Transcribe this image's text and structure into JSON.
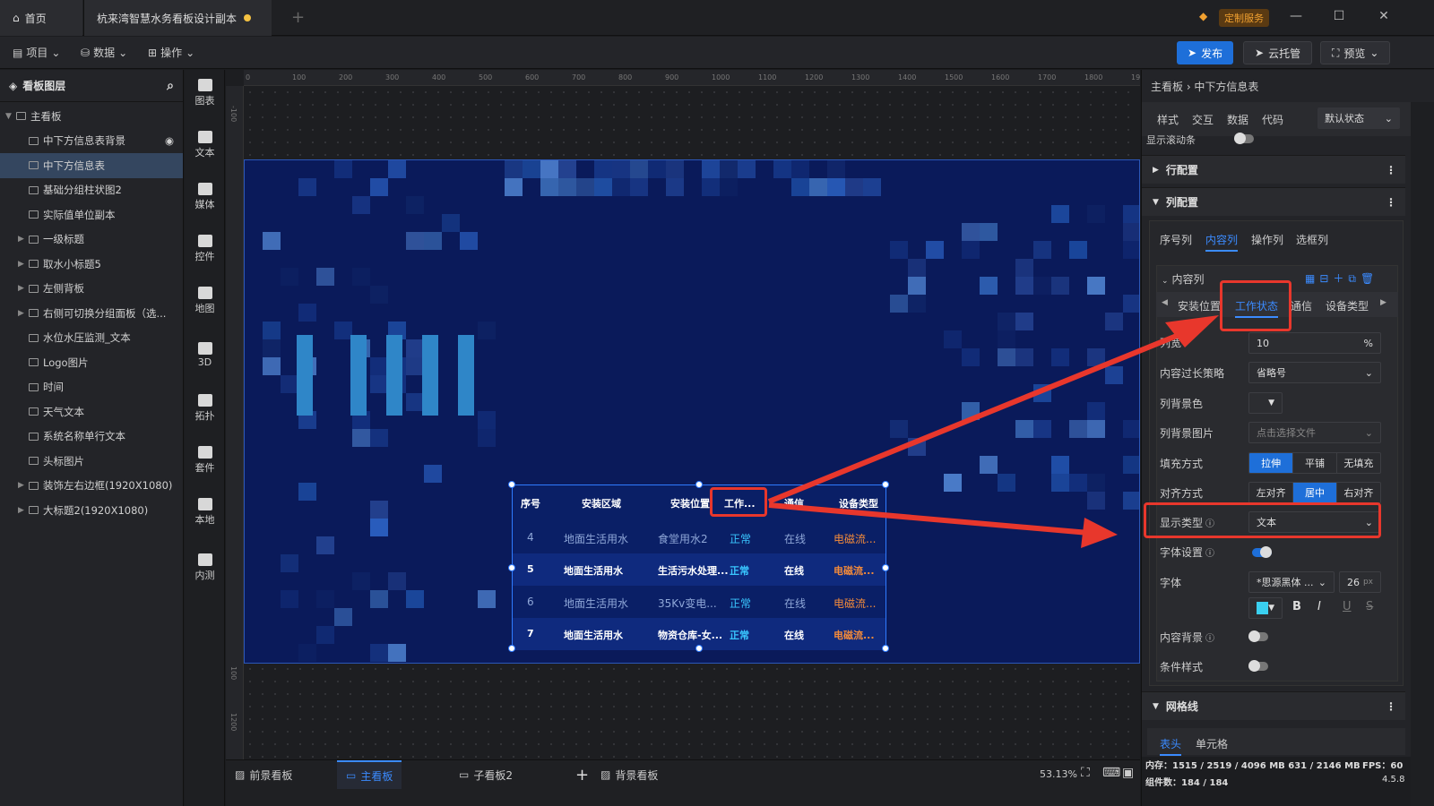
{
  "titlebar": {
    "home_tab": "首页",
    "doc_tab": "杭来湾智慧水务看板设计副本",
    "custom_service": "定制服务"
  },
  "toolbar": {
    "project": "项目",
    "data": "数据",
    "operation": "操作",
    "publish": "发布",
    "cloud": "云托管",
    "preview": "预览"
  },
  "layers": {
    "title": "看板图层",
    "items": [
      {
        "label": "主看板",
        "expanded": true
      },
      {
        "label": "中下方信息表背景"
      },
      {
        "label": "中下方信息表"
      },
      {
        "label": "基础分组柱状图2"
      },
      {
        "label": "实际值单位副本"
      },
      {
        "label": "一级标题"
      },
      {
        "label": "取水小标题5"
      },
      {
        "label": "左侧背板"
      },
      {
        "label": "右侧可切换分组面板（选..."
      },
      {
        "label": "水位水压监测_文本"
      },
      {
        "label": "Logo图片"
      },
      {
        "label": "时间"
      },
      {
        "label": "天气文本"
      },
      {
        "label": "系统名称单行文本"
      },
      {
        "label": "头标图片"
      },
      {
        "label": "装饰左右边框(1920X1080)"
      },
      {
        "label": "大标题2(1920X1080)"
      }
    ]
  },
  "tools": [
    "图表",
    "文本",
    "媒体",
    "控件",
    "地图",
    "3D",
    "拓扑",
    "套件",
    "本地",
    "内测"
  ],
  "ruler": {
    "top": [
      "0",
      "100",
      "200",
      "300",
      "400",
      "500",
      "600",
      "700",
      "800",
      "900",
      "1000",
      "1100",
      "1200",
      "1300",
      "1400",
      "1500",
      "1600",
      "1700",
      "1800",
      "1900"
    ],
    "left": [
      "-100",
      "100",
      "1200"
    ]
  },
  "table_widget": {
    "headers": [
      "序号",
      "安装区域",
      "安装位置",
      "工作...",
      "通信",
      "设备类型"
    ],
    "rows": [
      [
        "4",
        "地面生活用水",
        "食堂用水2",
        "正常",
        "在线",
        "电磁流..."
      ],
      [
        "5",
        "地面生活用水",
        "生活污水处理...",
        "正常",
        "在线",
        "电磁流..."
      ],
      [
        "6",
        "地面生活用水",
        "35Kv变电...",
        "正常",
        "在线",
        "电磁流..."
      ],
      [
        "7",
        "地面生活用水",
        "物资仓库-女...",
        "正常",
        "在线",
        "电磁流..."
      ]
    ]
  },
  "right_panel": {
    "breadcrumb": "主看板 › 中下方信息表",
    "tabs": [
      "样式",
      "交互",
      "数据",
      "代码"
    ],
    "state": "默认状态",
    "scroll_label": "显示滚动条",
    "row_config": "行配置",
    "col_config": "列配置",
    "col_tabs": [
      "序号列",
      "内容列",
      "操作列",
      "选框列"
    ],
    "content_col": "内容列",
    "content_tabs": [
      "安装位置",
      "工作状态",
      "通信",
      "设备类型"
    ],
    "width_label": "列宽",
    "width_value": "10",
    "width_unit": "%",
    "overflow_label": "内容过长策略",
    "overflow_value": "省略号",
    "bg_label": "列背景色",
    "bgimg_label": "列背景图片",
    "bgimg_value": "点击选择文件",
    "fill_label": "填充方式",
    "fill_options": [
      "拉伸",
      "平铺",
      "无填充"
    ],
    "align_label": "对齐方式",
    "align_options": [
      "左对齐",
      "居中",
      "右对齐"
    ],
    "display_label": "显示类型",
    "display_value": "文本",
    "font_setting_label": "字体设置",
    "font_label": "字体",
    "font_value": "*思源黑体 ...",
    "font_size": "26",
    "font_unit": "px",
    "content_bg_label": "内容背景",
    "cond_style_label": "条件样式",
    "grid_label": "网格线",
    "grid_tabs": [
      "表头",
      "单元格"
    ],
    "style_b": "B",
    "style_i": "I",
    "style_u": "U",
    "style_s": "S"
  },
  "bottom": {
    "tabs": [
      "前景看板",
      "主看板",
      "子看板2",
      "背景看板"
    ],
    "zoom": "53.13%",
    "memory": "内存：1515 / 2519 / 4096 MB  631 / 2146 MB",
    "components": "组件数：184 / 184",
    "fps": "FPS：60",
    "version": "4.5.8"
  }
}
